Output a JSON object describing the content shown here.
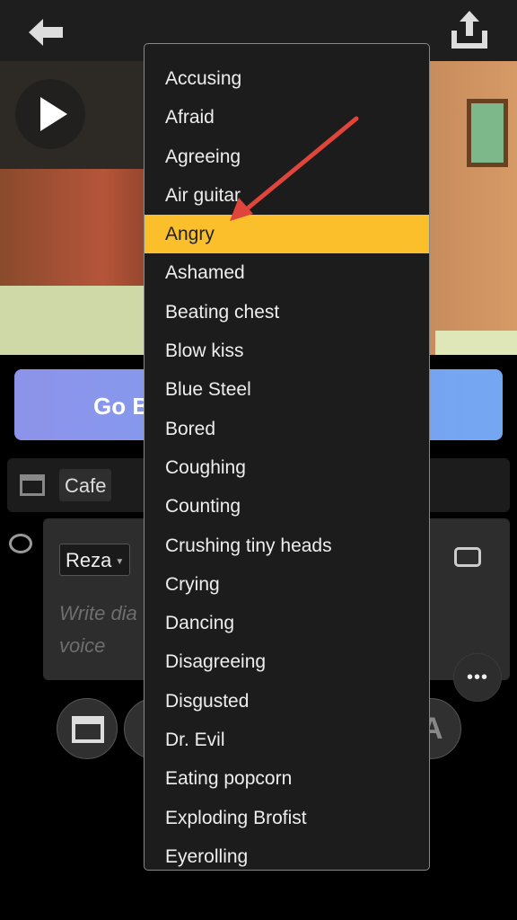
{
  "toolbar": {
    "back_icon": "arrow-left-icon",
    "share_icon": "upload-tray-icon"
  },
  "preview": {
    "play_icon": "play-icon"
  },
  "go_button": {
    "label": "Go B"
  },
  "scene_row": {
    "icon": "clapperboard-icon",
    "scene": "Cafe"
  },
  "dialogue": {
    "icon": "speech-bubble-icon",
    "character": "Reza",
    "placeholder_line1": "Write dia",
    "placeholder_line2": "voice",
    "camera_icon": "camera-icon",
    "more_label": "•••"
  },
  "bottom_bar": {
    "partial_label": "A"
  },
  "menu": {
    "selected": "Angry",
    "highlight_color": "#fbbf2c",
    "items": [
      "Accusing",
      "Afraid",
      "Agreeing",
      "Air guitar",
      "Angry",
      "Ashamed",
      "Beating chest",
      "Blow kiss",
      "Blue Steel",
      "Bored",
      "Coughing",
      "Counting",
      "Crushing tiny heads",
      "Crying",
      "Dancing",
      "Disagreeing",
      "Disgusted",
      "Dr. Evil",
      "Eating popcorn",
      "Exploding Brofist",
      "Eyerolling"
    ]
  },
  "annotation": {
    "arrow_color": "#e0453c"
  }
}
